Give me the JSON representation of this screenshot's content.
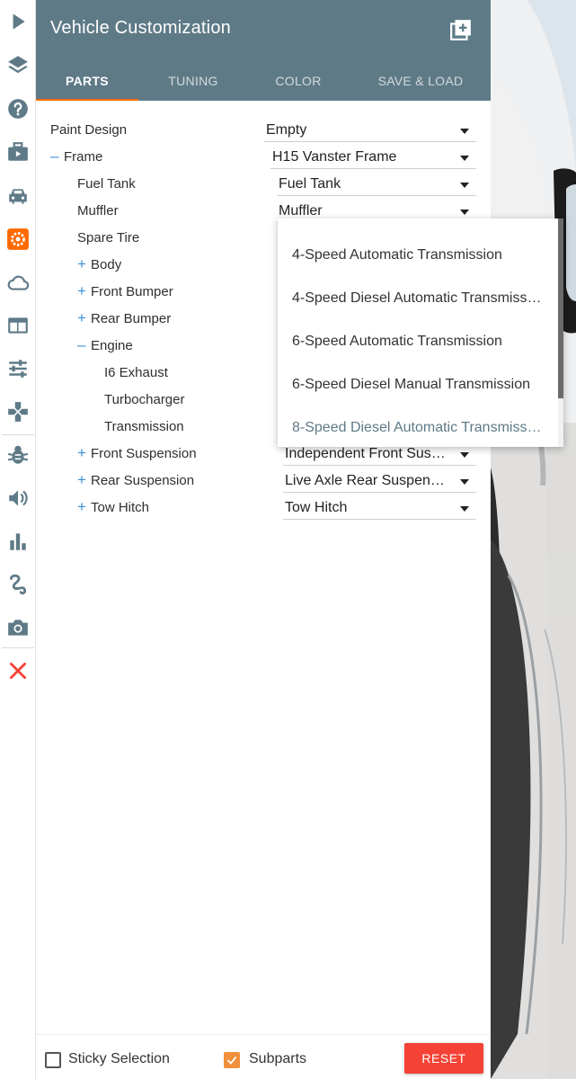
{
  "panel": {
    "title": "Vehicle Customization"
  },
  "tabs": [
    {
      "label": "PARTS",
      "active": true
    },
    {
      "label": "TUNING",
      "active": false
    },
    {
      "label": "COLOR",
      "active": false
    },
    {
      "label": "SAVE & LOAD",
      "active": false
    }
  ],
  "tree": [
    {
      "label": "Paint Design",
      "toggle": "",
      "value": "Empty"
    },
    {
      "label": "Frame",
      "toggle": "–",
      "value": "H15 Vanster Frame"
    },
    {
      "label": "Fuel Tank",
      "toggle": "",
      "value": "Fuel Tank"
    },
    {
      "label": "Muffler",
      "toggle": "",
      "value": "Muffler"
    },
    {
      "label": "Spare Tire",
      "toggle": "",
      "value": ""
    },
    {
      "label": "Body",
      "toggle": "+",
      "value": ""
    },
    {
      "label": "Front Bumper",
      "toggle": "+",
      "value": ""
    },
    {
      "label": "Rear Bumper",
      "toggle": "+",
      "value": ""
    },
    {
      "label": "Engine",
      "toggle": "–",
      "value": ""
    },
    {
      "label": "I6 Exhaust",
      "toggle": "",
      "value": ""
    },
    {
      "label": "Turbocharger",
      "toggle": "",
      "value": ""
    },
    {
      "label": "Transmission",
      "toggle": "",
      "value": ""
    },
    {
      "label": "Front Suspension",
      "toggle": "+",
      "value": "Independent Front Sus…"
    },
    {
      "label": "Rear Suspension",
      "toggle": "+",
      "value": "Live Axle Rear Suspens…"
    },
    {
      "label": "Tow Hitch",
      "toggle": "+",
      "value": "Tow Hitch"
    }
  ],
  "dropdown": {
    "options": [
      "4-Speed Automatic Transmission",
      "4-Speed Diesel Automatic Transmission",
      "6-Speed Automatic Transmission",
      "6-Speed Diesel Manual Transmission",
      "8-Speed Diesel Automatic Transmission"
    ],
    "highlighted_index": 4
  },
  "footer": {
    "sticky_label": "Sticky Selection",
    "sticky_checked": false,
    "subparts_label": "Subparts",
    "subparts_checked": true,
    "reset_label": "RESET"
  },
  "colors": {
    "header": "#5f7a87",
    "accent": "#ff6a00",
    "tree_toggle": "#3b8fd4",
    "reset": "#f44336",
    "sidebar_icon": "#5f7a87",
    "close_icon": "#f44336"
  },
  "sidebar": {
    "icons": [
      "play-icon",
      "layers-icon",
      "help-icon",
      "briefcase-icon",
      "car-icon",
      "settings-icon",
      "cloud-icon",
      "browser-icon",
      "tune-icon",
      "gamepad-icon",
      "bug-icon",
      "volume-icon",
      "bar-chart-icon",
      "route-icon",
      "camera-icon",
      "close-icon"
    ],
    "active_icon": "settings-icon"
  }
}
